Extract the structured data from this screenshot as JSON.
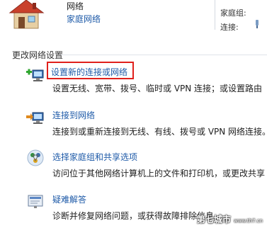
{
  "network": {
    "name": "网络",
    "type": "家庭网络"
  },
  "homegroup": {
    "label": "家庭组:"
  },
  "connection": {
    "label": "连接:"
  },
  "section_title": "更改网络设置",
  "tasks": [
    {
      "title": "设置新的连接或网络",
      "desc": "设置无线、宽带、拨号、临时或 VPN 连接；或设置路由",
      "icon": "new-connection-icon",
      "highlighted": true
    },
    {
      "title": "连接到网络",
      "desc": "连接到或重新连接到无线、有线、拨号或 VPN 网络连接。",
      "icon": "connect-network-icon"
    },
    {
      "title": "选择家庭组和共享选项",
      "desc": "访问位于其他网络计算机上的文件和打印机，或更改共享",
      "icon": "homegroup-sharing-icon"
    },
    {
      "title": "疑难解答",
      "desc": "诊断并修复网络问题，或获得故障排除信息。",
      "icon": "troubleshoot-icon"
    }
  ],
  "watermark": {
    "main": "第七城市",
    "sub": "www.th7.cn"
  },
  "colors": {
    "link": "#1e5aa8",
    "highlight": "#e0201c"
  }
}
